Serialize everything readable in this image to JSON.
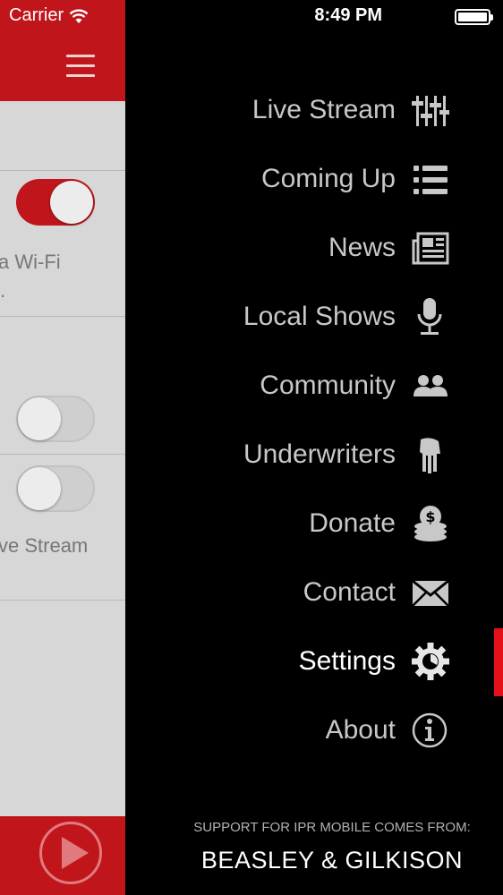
{
  "status_bar": {
    "carrier": "Carrier",
    "time": "8:49 PM"
  },
  "background_screen": {
    "wifi_text_1": "a Wi-Fi",
    "wifi_text_2": ".",
    "stream_text": "ve Stream",
    "toggles": [
      {
        "name": "wifi-only-toggle",
        "on": true
      },
      {
        "name": "setting-toggle-2",
        "on": false
      },
      {
        "name": "live-stream-toggle",
        "on": false
      }
    ]
  },
  "menu": {
    "items": [
      {
        "label": "Live Stream",
        "icon": "sliders-icon"
      },
      {
        "label": "Coming Up",
        "icon": "list-icon"
      },
      {
        "label": "News",
        "icon": "newspaper-icon"
      },
      {
        "label": "Local Shows",
        "icon": "microphone-icon"
      },
      {
        "label": "Community",
        "icon": "people-icon"
      },
      {
        "label": "Underwriters",
        "icon": "hand-icon"
      },
      {
        "label": "Donate",
        "icon": "coins-icon"
      },
      {
        "label": "Contact",
        "icon": "envelope-icon"
      },
      {
        "label": "Settings",
        "icon": "gear-icon",
        "active": true
      },
      {
        "label": "About",
        "icon": "info-icon"
      }
    ]
  },
  "sponsor": {
    "caption": "SUPPORT FOR IPR MOBILE COMES FROM:",
    "name": "BEASLEY & GILKISON"
  },
  "colors": {
    "accent": "#c0151b",
    "active_indicator": "#e3101a",
    "menu_bg": "#000000"
  }
}
